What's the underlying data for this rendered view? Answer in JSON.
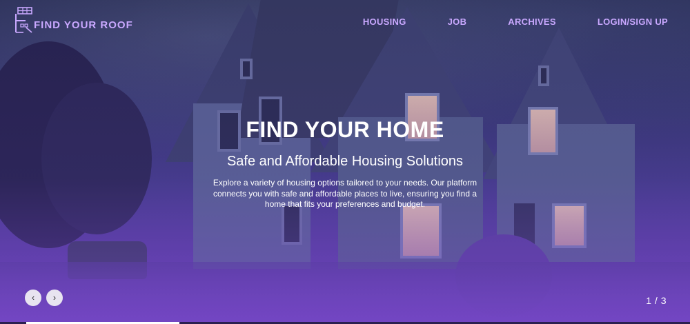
{
  "brand": {
    "name": "FIND YOUR ROOF",
    "icon": "house-logo-icon",
    "color": "#c9a8ff"
  },
  "nav": {
    "items": [
      {
        "label": "HOUSING"
      },
      {
        "label": "JOB"
      },
      {
        "label": "ARCHIVES"
      },
      {
        "label": "LOGIN/SIGN UP"
      }
    ]
  },
  "hero": {
    "title": "FIND YOUR HOME",
    "subtitle": "Safe and Affordable Housing Solutions",
    "description": "Explore a variety of housing options tailored to your needs. Our platform connects you with safe and affordable places to live, ensuring you find a home that fits your preferences and budget."
  },
  "slider": {
    "prev_icon": "chevron-left-icon",
    "next_icon": "chevron-right-icon",
    "prev_glyph": "‹",
    "next_glyph": "›",
    "counter": "1 / 3",
    "progress": 0.333
  },
  "colors": {
    "accent": "#c9a8ff",
    "overlay": "#6b46b8"
  }
}
